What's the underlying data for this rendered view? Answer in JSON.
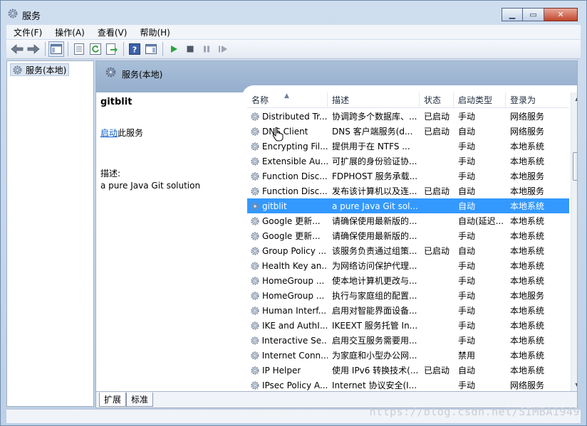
{
  "window": {
    "title": "服务"
  },
  "menu": [
    "文件(F)",
    "操作(A)",
    "查看(V)",
    "帮助(H)"
  ],
  "tree": {
    "node_label": "服务(本地)"
  },
  "main": {
    "header_title": "服务(本地)"
  },
  "detail": {
    "service_name": "gitblit",
    "start_link": "启动",
    "start_suffix": "此服务",
    "desc_label": "描述:",
    "desc_text": "a pure Java Git solution"
  },
  "columns": {
    "name": "名称",
    "desc": "描述",
    "status": "状态",
    "start_type": "启动类型",
    "login": "登录为"
  },
  "rows": [
    {
      "name": "Distributed Tr...",
      "desc": "协调跨多个数据库、...",
      "status": "已启动",
      "start_type": "手动",
      "login": "网络服务"
    },
    {
      "name": "DNS Client",
      "desc": "DNS 客户端服务(d...",
      "status": "已启动",
      "start_type": "自动",
      "login": "网络服务"
    },
    {
      "name": "Encrypting Fil...",
      "desc": "提供用于在 NTFS ...",
      "status": "",
      "start_type": "手动",
      "login": "本地系统"
    },
    {
      "name": "Extensible Au...",
      "desc": "可扩展的身份验证协...",
      "status": "",
      "start_type": "手动",
      "login": "本地系统"
    },
    {
      "name": "Function Disc...",
      "desc": "FDPHOST 服务承载...",
      "status": "",
      "start_type": "手动",
      "login": "本地服务"
    },
    {
      "name": "Function Disc...",
      "desc": "发布该计算机以及连...",
      "status": "已启动",
      "start_type": "自动",
      "login": "本地服务"
    },
    {
      "name": "gitblit",
      "desc": "a pure Java Git sol...",
      "status": "",
      "start_type": "自动",
      "login": "本地系统"
    },
    {
      "name": "Google 更新...",
      "desc": "请确保使用最新版的...",
      "status": "",
      "start_type": "自动(延迟...",
      "login": "本地系统"
    },
    {
      "name": "Google 更新...",
      "desc": "请确保使用最新版的...",
      "status": "",
      "start_type": "手动",
      "login": "本地系统"
    },
    {
      "name": "Group Policy ...",
      "desc": "该服务负责通过组策...",
      "status": "已启动",
      "start_type": "自动",
      "login": "本地系统"
    },
    {
      "name": "Health Key an...",
      "desc": "为网络访问保护代理...",
      "status": "",
      "start_type": "手动",
      "login": "本地系统"
    },
    {
      "name": "HomeGroup ...",
      "desc": "使本地计算机更改与...",
      "status": "",
      "start_type": "手动",
      "login": "本地系统"
    },
    {
      "name": "HomeGroup ...",
      "desc": "执行与家庭组的配置...",
      "status": "",
      "start_type": "手动",
      "login": "本地服务"
    },
    {
      "name": "Human Interf...",
      "desc": "启用对智能界面设备...",
      "status": "",
      "start_type": "手动",
      "login": "本地系统"
    },
    {
      "name": "IKE and AuthI...",
      "desc": "IKEEXT 服务托管 In...",
      "status": "",
      "start_type": "手动",
      "login": "本地系统"
    },
    {
      "name": "Interactive Se...",
      "desc": "启用交互服务需要用...",
      "status": "",
      "start_type": "手动",
      "login": "本地系统"
    },
    {
      "name": "Internet Conn...",
      "desc": "为家庭和小型办公网...",
      "status": "",
      "start_type": "禁用",
      "login": "本地系统"
    },
    {
      "name": "IP Helper",
      "desc": "使用 IPv6 转换技术(...",
      "status": "已启动",
      "start_type": "自动",
      "login": "本地系统"
    },
    {
      "name": "IPsec Policy A...",
      "desc": "Internet 协议安全(I...",
      "status": "",
      "start_type": "手动",
      "login": "网络服务"
    }
  ],
  "selected_row": 6,
  "tabs": [
    "扩展",
    "标准"
  ],
  "watermark": "https://blog.csdn.net/SIMBA1949",
  "colors": {
    "selection": "#3399ff",
    "header_band": "#a9bfd8",
    "link": "#0b5cc8"
  }
}
